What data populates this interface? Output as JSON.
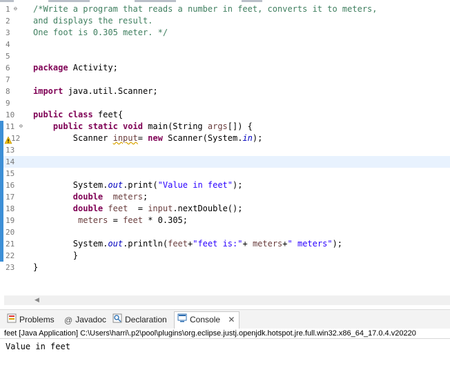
{
  "editor": {
    "lines": [
      {
        "n": "1",
        "fold": "⊖",
        "segs": [
          {
            "c": "cm",
            "t": "/*Write a program that reads a number in feet, converts it to meters,"
          }
        ]
      },
      {
        "n": "2",
        "segs": [
          {
            "c": "cm",
            "t": "and displays the result."
          }
        ]
      },
      {
        "n": "3",
        "segs": [
          {
            "c": "cm",
            "t": "One foot is 0.305 meter. */"
          }
        ]
      },
      {
        "n": "4",
        "segs": []
      },
      {
        "n": "5",
        "segs": []
      },
      {
        "n": "6",
        "segs": [
          {
            "c": "kw",
            "t": "package"
          },
          {
            "c": "",
            "t": " Activity;"
          }
        ]
      },
      {
        "n": "7",
        "segs": []
      },
      {
        "n": "8",
        "segs": [
          {
            "c": "kw",
            "t": "import"
          },
          {
            "c": "",
            "t": " java.util.Scanner;"
          }
        ]
      },
      {
        "n": "9",
        "segs": []
      },
      {
        "n": "10",
        "segs": [
          {
            "c": "kw",
            "t": "public class"
          },
          {
            "c": "",
            "t": " feet{"
          }
        ]
      },
      {
        "n": "11",
        "fold": "⊖",
        "marker": true,
        "segs": [
          {
            "c": "",
            "t": "    "
          },
          {
            "c": "kw",
            "t": "public static void"
          },
          {
            "c": "",
            "t": " main(String "
          },
          {
            "c": "var",
            "t": "args"
          },
          {
            "c": "",
            "t": "[]) {"
          }
        ]
      },
      {
        "n": "12",
        "marker": true,
        "warn": true,
        "segs": [
          {
            "c": "",
            "t": "        Scanner "
          },
          {
            "c": "var",
            "t": "input"
          },
          {
            "c": "",
            "t": "= "
          },
          {
            "c": "kw",
            "t": "new"
          },
          {
            "c": "",
            "t": " Scanner(System."
          },
          {
            "c": "fld",
            "t": "in"
          },
          {
            "c": "",
            "t": ");"
          }
        ]
      },
      {
        "n": "13",
        "marker": true,
        "segs": []
      },
      {
        "n": "14",
        "marker": true,
        "current": true,
        "segs": []
      },
      {
        "n": "15",
        "marker": true,
        "segs": []
      },
      {
        "n": "16",
        "marker": true,
        "segs": [
          {
            "c": "",
            "t": "        System."
          },
          {
            "c": "fld",
            "t": "out"
          },
          {
            "c": "",
            "t": ".print("
          },
          {
            "c": "str",
            "t": "\"Value in feet\""
          },
          {
            "c": "",
            "t": ");"
          }
        ]
      },
      {
        "n": "17",
        "marker": true,
        "segs": [
          {
            "c": "",
            "t": "        "
          },
          {
            "c": "kw",
            "t": "double"
          },
          {
            "c": "",
            "t": "  "
          },
          {
            "c": "var",
            "t": "meters"
          },
          {
            "c": "",
            "t": ";"
          }
        ]
      },
      {
        "n": "18",
        "marker": true,
        "segs": [
          {
            "c": "",
            "t": "        "
          },
          {
            "c": "kw",
            "t": "double"
          },
          {
            "c": "",
            "t": " "
          },
          {
            "c": "var",
            "t": "feet"
          },
          {
            "c": "",
            "t": "  = "
          },
          {
            "c": "var",
            "t": "input"
          },
          {
            "c": "",
            "t": ".nextDouble();"
          }
        ]
      },
      {
        "n": "19",
        "marker": true,
        "segs": [
          {
            "c": "",
            "t": "         "
          },
          {
            "c": "var",
            "t": "meters"
          },
          {
            "c": "",
            "t": " = "
          },
          {
            "c": "var",
            "t": "feet"
          },
          {
            "c": "",
            "t": " * 0.305;"
          }
        ]
      },
      {
        "n": "20",
        "marker": true,
        "segs": []
      },
      {
        "n": "21",
        "marker": true,
        "segs": [
          {
            "c": "",
            "t": "        System."
          },
          {
            "c": "fld",
            "t": "out"
          },
          {
            "c": "",
            "t": ".println("
          },
          {
            "c": "var",
            "t": "feet"
          },
          {
            "c": "",
            "t": "+"
          },
          {
            "c": "str",
            "t": "\"feet is:\""
          },
          {
            "c": "",
            "t": "+ "
          },
          {
            "c": "var",
            "t": "meters"
          },
          {
            "c": "",
            "t": "+"
          },
          {
            "c": "str",
            "t": "\" meters\""
          },
          {
            "c": "",
            "t": ");"
          }
        ]
      },
      {
        "n": "22",
        "marker": true,
        "segs": [
          {
            "c": "",
            "t": "        }"
          }
        ]
      },
      {
        "n": "23",
        "segs": [
          {
            "c": "",
            "t": "}"
          }
        ]
      }
    ]
  },
  "panel": {
    "tabs": [
      {
        "label": "Problems",
        "icon": "problems-icon"
      },
      {
        "label": "Javadoc",
        "icon": "javadoc-icon"
      },
      {
        "label": "Declaration",
        "icon": "declaration-icon"
      },
      {
        "label": "Console",
        "icon": "console-icon",
        "active": true
      }
    ],
    "close_glyph": "✕",
    "console_header": "feet [Java Application] C:\\Users\\harri\\.p2\\pool\\plugins\\org.eclipse.justj.openjdk.hotspot.jre.full.win32.x86_64_17.0.4.v20220",
    "console_output": "Value in feet"
  },
  "colors": {
    "keyword": "#7f0055",
    "comment": "#3f7f5f",
    "string": "#2a00ff",
    "field": "#0000c0",
    "current_line": "#e8f2fe",
    "change_marker": "#3d8fd6"
  }
}
